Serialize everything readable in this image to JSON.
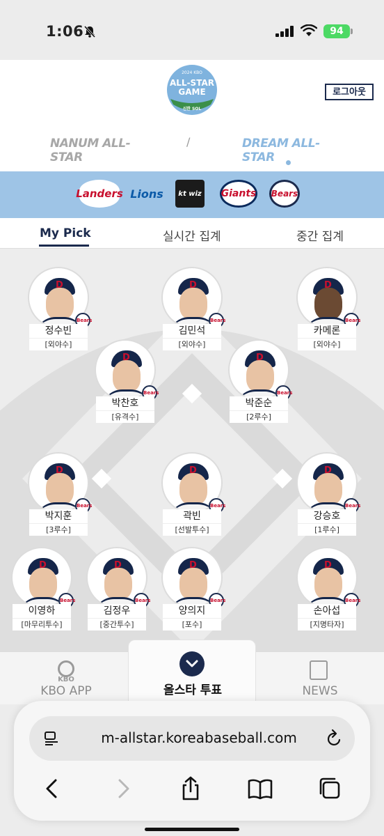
{
  "status_bar": {
    "time": "1:06",
    "battery": "94"
  },
  "header": {
    "logo": {
      "top_text": "2024 KBO",
      "line1": "ALL-STAR",
      "line2": "GAME",
      "sponsor": "신한 SOL"
    },
    "logout_label": "로그아웃",
    "leagues": [
      {
        "label": "NANUM ALL-STAR",
        "color": "#a7a7a7"
      },
      {
        "label": "DREAM ALL-STAR",
        "color": "#8cb8df",
        "selected": true
      }
    ],
    "separator": "/"
  },
  "teams": [
    {
      "label": "Landers"
    },
    {
      "label": "Lions"
    },
    {
      "label": "kt wiz"
    },
    {
      "label": "Giants"
    },
    {
      "label": "Bears"
    }
  ],
  "tabs": [
    {
      "label": "My Pick",
      "active": true
    },
    {
      "label": "실시간 집계"
    },
    {
      "label": "중간 집계"
    }
  ],
  "players": [
    {
      "name": "정수빈",
      "position": "[외야수]",
      "team_badge": "Bears"
    },
    {
      "name": "김민석",
      "position": "[외야수]",
      "team_badge": "Bears"
    },
    {
      "name": "카메론",
      "position": "[외야수]",
      "team_badge": "Bears"
    },
    {
      "name": "박찬호",
      "position": "[유격수]",
      "team_badge": "Bears"
    },
    {
      "name": "박준순",
      "position": "[2루수]",
      "team_badge": "Bears"
    },
    {
      "name": "박지훈",
      "position": "[3루수]",
      "team_badge": "Bears"
    },
    {
      "name": "곽빈",
      "position": "[선발투수]",
      "team_badge": "Bears"
    },
    {
      "name": "강승호",
      "position": "[1루수]",
      "team_badge": "Bears"
    },
    {
      "name": "이영하",
      "position": "[마무리투수]",
      "team_badge": "Bears"
    },
    {
      "name": "김정우",
      "position": "[중간투수]",
      "team_badge": "Bears"
    },
    {
      "name": "양의지",
      "position": "[포수]",
      "team_badge": "Bears"
    },
    {
      "name": "손아섭",
      "position": "[지명타자]",
      "team_badge": "Bears"
    }
  ],
  "bottom_nav": {
    "kbo_app": {
      "sub": "KBO",
      "label": "KBO APP",
      "icon": "kbo-logo-icon"
    },
    "vote": {
      "label": "올스타 투표",
      "icon": "chevron-down-icon"
    },
    "news": {
      "label": "NEWS",
      "icon": "newspaper-icon"
    }
  },
  "browser": {
    "url": "m-allstar.koreabaseball.com"
  },
  "colors": {
    "navy": "#1b2a4d",
    "team_strip": "#9ec4e6",
    "dream_blue": "#8cb8df",
    "bears_red": "#c8102e"
  }
}
